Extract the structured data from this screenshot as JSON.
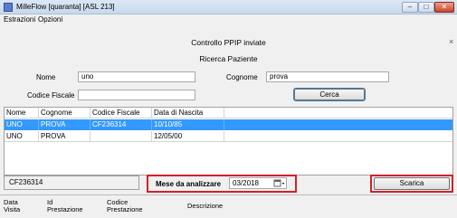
{
  "window": {
    "title": "MilleFlow [quaranta] [ASL 213]",
    "min_label": "‒",
    "max_label": "□",
    "close_label": "✕"
  },
  "menu": [
    "Estrazioni",
    "Opzioni"
  ],
  "panel": {
    "title": "Controllo PPIP inviate",
    "close_label": "×",
    "subtitle": "Ricerca Paziente"
  },
  "search": {
    "nome_label": "Nome",
    "nome_value": "uno",
    "cognome_label": "Cognome",
    "cognome_value": "prova",
    "cf_label": "Codice Fiscale",
    "cf_value": "",
    "cerca_label": "Cerca"
  },
  "results": {
    "columns": [
      "Nome",
      "Cognome",
      "Codice Fiscale",
      "Data di Nascita"
    ],
    "rows": [
      [
        "UNO",
        "PROVA",
        "CF236314",
        "10/10/85"
      ],
      [
        "UNO",
        "PROVA",
        "",
        "12/05/00"
      ]
    ]
  },
  "bottom": {
    "selected_cf": "CF236314",
    "mese_label": "Mese da analizzare",
    "mese_value": "03/2018",
    "calendar_icon": "calendar-dropdown-icon",
    "scarica_label": "Scarica"
  },
  "detail_columns": {
    "data_visita": "Data\nVisita",
    "id_prestazione": "Id\nPrestazione",
    "codice_prestazione": "Codice\nPrestazione",
    "descrizione": "Descrizione"
  },
  "colors": {
    "selection": "#3399ff",
    "highlight_box": "#d4202a"
  }
}
